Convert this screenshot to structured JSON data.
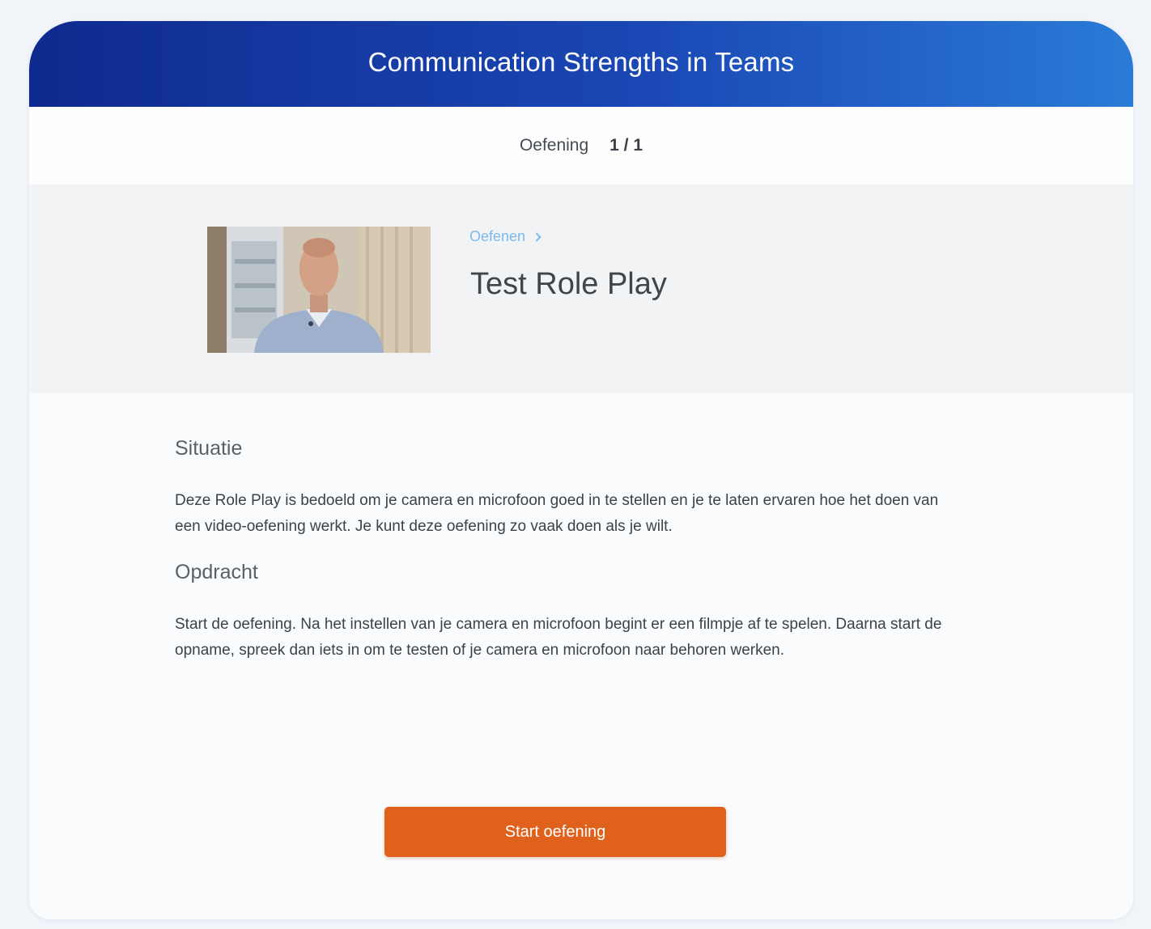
{
  "header": {
    "title": "Communication Strengths in Teams"
  },
  "progress": {
    "label": "Oefening",
    "count": "1 / 1"
  },
  "exercise": {
    "breadcrumb": "Oefenen",
    "title": "Test Role Play",
    "thumbnail_icon": "video-thumbnail"
  },
  "sections": {
    "situation": {
      "heading": "Situatie",
      "text": "Deze Role Play is bedoeld om je camera en microfoon goed in te stellen en je te laten ervaren hoe het doen van een video-oefening werkt. Je kunt deze oefening zo vaak doen als je wilt."
    },
    "assignment": {
      "heading": "Opdracht",
      "text": "Start de oefening. Na het instellen van je camera en microfoon begint er een filmpje af te spelen. Daarna start de opname, spreek dan iets in om te testen of je camera en microfoon naar behoren werken."
    }
  },
  "actions": {
    "start_label": "Start oefening"
  },
  "colors": {
    "header_start": "#0f2a8e",
    "header_end": "#2a7bd7",
    "accent_button": "#e0611c",
    "breadcrumb": "#7fb9ec"
  }
}
